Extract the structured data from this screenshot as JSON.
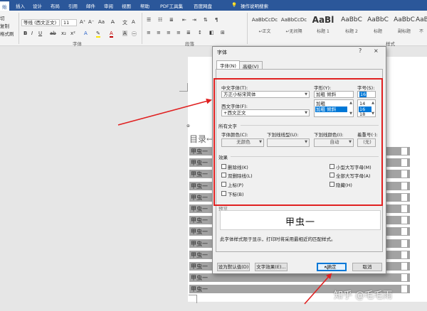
{
  "ribbon": {
    "tabs": [
      "始",
      "插入",
      "设计",
      "布局",
      "引用",
      "邮件",
      "审阅",
      "视图",
      "帮助",
      "PDF工具集",
      "百度网盘"
    ],
    "tell_me": "操作说明搜索",
    "left_commands": [
      "切",
      "复制",
      "格式刷"
    ],
    "font_name": "等线 (西文正文)",
    "font_size": "11",
    "group_font": "字体",
    "group_paragraph": "段落",
    "group_styles": "样式",
    "styles": [
      {
        "preview": "AaBbCcDc",
        "name": "正文"
      },
      {
        "preview": "AaBbCcDc",
        "name": "无间隔"
      },
      {
        "preview": "AaBl",
        "name": "标题 1"
      },
      {
        "preview": "AaBbC",
        "name": "标题 2"
      },
      {
        "preview": "AaBbC",
        "name": "标题"
      },
      {
        "preview": "AaBbC",
        "name": "副标题"
      },
      {
        "preview": "AaBbC",
        "name": "不"
      }
    ]
  },
  "document": {
    "toc_title": "目录↩",
    "row_text": "甲虫一",
    "rows": 13
  },
  "dialog": {
    "title": "字体",
    "help": "?",
    "close": "×",
    "tabs": [
      "字体(N)",
      "高级(V)"
    ],
    "chinese_font_label": "中文字体(T):",
    "chinese_font_value": "方正小标宋简体",
    "style_label": "字形(Y):",
    "style_value": "加粗 倾斜",
    "size_label": "字号(S):",
    "size_value": "16",
    "western_font_label": "西文字体(F):",
    "western_font_value": "+西文正文",
    "style_list": [
      "加粗",
      "加粗 倾斜"
    ],
    "size_list": [
      "14",
      "16",
      "18"
    ],
    "all_text_label": "所有文字",
    "font_color_label": "字体颜色(C):",
    "font_color_value": "无颜色",
    "underline_type_label": "下划线线型(U):",
    "underline_type_value": "",
    "underline_color_label": "下划线颜色(I):",
    "underline_color_value": "自动",
    "emphasis_label": "着重号(·):",
    "emphasis_value": "(无)",
    "effects_label": "效果",
    "effects_left": [
      "删除线(K)",
      "双删除线(L)",
      "上标(P)",
      "下标(B)"
    ],
    "effects_right": [
      "小型大写字母(M)",
      "全部大写字母(A)",
      "隐藏(H)"
    ],
    "preview_label": "预览",
    "preview_text": "甲虫一",
    "note": "此字体样式限于显示，打印时将采用最相近的匹配样式。",
    "set_default": "设为默认值(D)",
    "text_effects": "文字效果(E)...",
    "ok": "确定",
    "cancel": "取消"
  },
  "watermark": "知乎 @毛毛雨"
}
